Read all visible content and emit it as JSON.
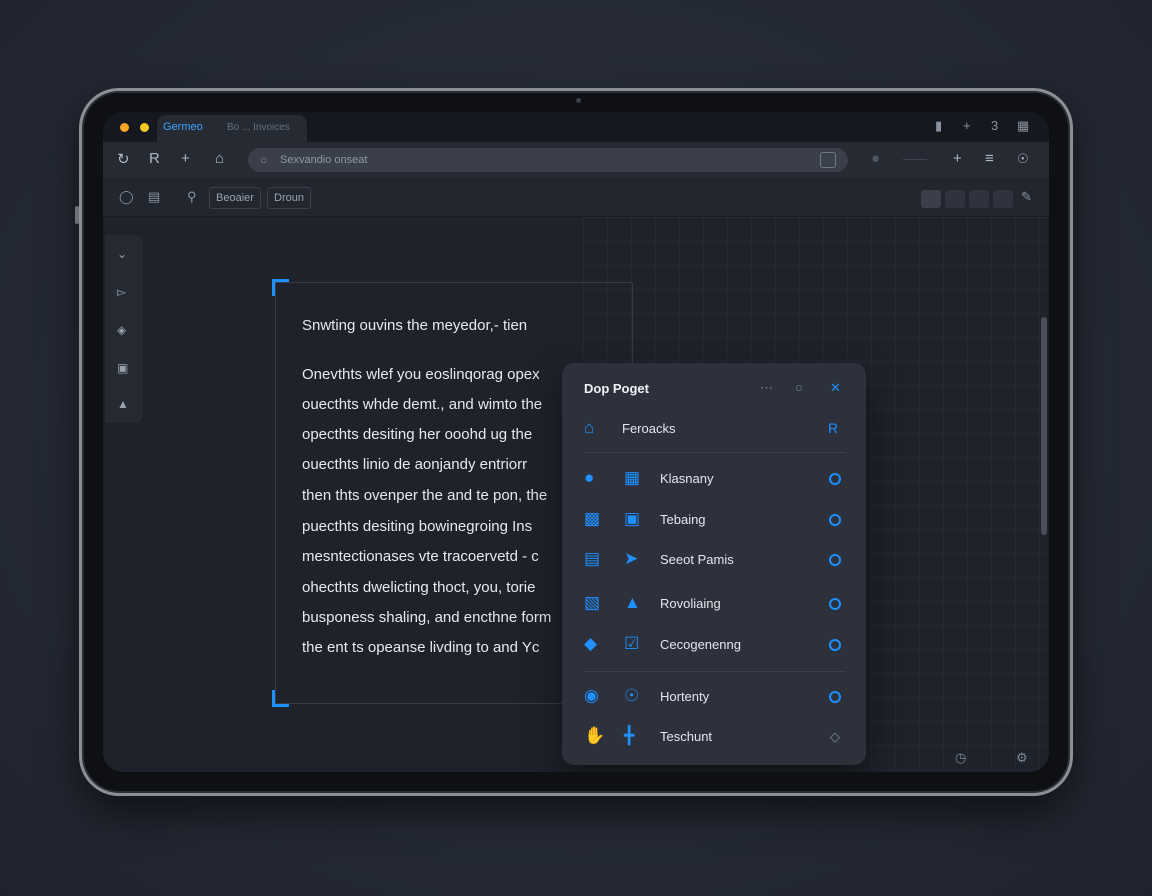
{
  "tab": {
    "title": "Germeo",
    "subtitle": "Bo ... Invoices"
  },
  "address": {
    "text": "Sexvandio onseat"
  },
  "bookmarks": [
    "Beoaier",
    "Droun"
  ],
  "document": {
    "heading": "Snwting ouvins the meyedor,- tien",
    "lines": [
      "Onevthts wlef you eoslinqorag opex",
      "ouecthts whde demt., and wimto the",
      "opecthts desiting her ooohd ug the",
      "ouecthts linio de aonjandy entriorr",
      "then thts ovenper the and te pon, the",
      "puecthts desiting bowinegroing Ins",
      "mesntectionases vte tracoervetd - c",
      "ohecthts dwelicting thoct, you, torie",
      "busponess shaling, and encthne form",
      "the ent ts opeanse livding to and Yc"
    ]
  },
  "panel": {
    "title": "Dop Poget",
    "header": {
      "label": "Feroacks",
      "icon_a": "home-icon",
      "badge": "R"
    },
    "items": [
      {
        "label": "Klasnany",
        "icon_a": "chat-bubble-icon",
        "icon_b": "grid-window-icon"
      },
      {
        "label": "Tebaing",
        "icon_a": "shield-icon",
        "icon_b": "image-icon"
      },
      {
        "label": "Seeot Pamis",
        "icon_a": "message-lines-icon",
        "icon_b": "send-icon"
      },
      {
        "label": "Rovoliaing",
        "icon_a": "document-icon",
        "icon_b": "drop-icon"
      },
      {
        "label": "Cecogenenng",
        "icon_a": "eye-icon",
        "icon_b": "checkbox-icon"
      },
      {
        "label": "Hortenty",
        "icon_a": "location-pin-icon",
        "icon_b": "globe-icon"
      },
      {
        "label": "Teschunt",
        "icon_a": "hand-icon",
        "icon_b": "layout-icon"
      }
    ]
  },
  "colors": {
    "accent": "#1e90ff",
    "background": "#252a36",
    "panel": "#2c313c"
  }
}
